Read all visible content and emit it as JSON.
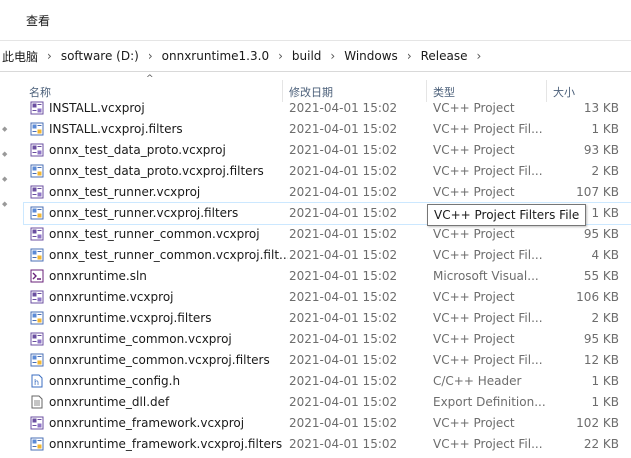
{
  "ribbon": {
    "view_tab": "查看"
  },
  "breadcrumb": {
    "items": [
      "此电脑",
      "software (D:)",
      "onnxruntime1.3.0",
      "build",
      "Windows",
      "Release"
    ],
    "separator": "›"
  },
  "columns": {
    "name": "名称",
    "modified": "修改日期",
    "type": "类型",
    "size": "大小",
    "sort_indicator": "^"
  },
  "tooltip": "VC++ Project Filters File",
  "colors": {
    "selection_border": "#cce8ff",
    "header_text": "#4c607a",
    "secondary_text": "#6d6d6d"
  },
  "files": [
    {
      "name": "INSTALL.vcxproj",
      "date": "2021-04-01 15:02",
      "type": "VC++ Project",
      "size": "13 KB",
      "icon": "vcxproj-icon"
    },
    {
      "name": "INSTALL.vcxproj.filters",
      "date": "2021-04-01 15:02",
      "type": "VC++ Project Fil...",
      "size": "1 KB",
      "icon": "filters-icon"
    },
    {
      "name": "onnx_test_data_proto.vcxproj",
      "date": "2021-04-01 15:02",
      "type": "VC++ Project",
      "size": "93 KB",
      "icon": "vcxproj-icon"
    },
    {
      "name": "onnx_test_data_proto.vcxproj.filters",
      "date": "2021-04-01 15:02",
      "type": "VC++ Project Fil...",
      "size": "2 KB",
      "icon": "filters-icon"
    },
    {
      "name": "onnx_test_runner.vcxproj",
      "date": "2021-04-01 15:02",
      "type": "VC++ Project",
      "size": "107 KB",
      "icon": "vcxproj-icon"
    },
    {
      "name": "onnx_test_runner.vcxproj.filters",
      "date": "2021-04-01 15:02",
      "type": "VC++ Project Filters File",
      "size": "1 KB",
      "icon": "filters-icon"
    },
    {
      "name": "onnx_test_runner_common.vcxproj",
      "date": "2021-04-01 15:02",
      "type": "VC++ Project",
      "size": "95 KB",
      "icon": "vcxproj-icon"
    },
    {
      "name": "onnx_test_runner_common.vcxproj.filt...",
      "date": "2021-04-01 15:02",
      "type": "VC++ Project Fil...",
      "size": "4 KB",
      "icon": "filters-icon"
    },
    {
      "name": "onnxruntime.sln",
      "date": "2021-04-01 15:02",
      "type": "Microsoft Visual...",
      "size": "55 KB",
      "icon": "sln-icon"
    },
    {
      "name": "onnxruntime.vcxproj",
      "date": "2021-04-01 15:02",
      "type": "VC++ Project",
      "size": "106 KB",
      "icon": "vcxproj-icon"
    },
    {
      "name": "onnxruntime.vcxproj.filters",
      "date": "2021-04-01 15:02",
      "type": "VC++ Project Fil...",
      "size": "2 KB",
      "icon": "filters-icon"
    },
    {
      "name": "onnxruntime_common.vcxproj",
      "date": "2021-04-01 15:02",
      "type": "VC++ Project",
      "size": "95 KB",
      "icon": "vcxproj-icon"
    },
    {
      "name": "onnxruntime_common.vcxproj.filters",
      "date": "2021-04-01 15:02",
      "type": "VC++ Project Fil...",
      "size": "12 KB",
      "icon": "filters-icon"
    },
    {
      "name": "onnxruntime_config.h",
      "date": "2021-04-01 15:02",
      "type": "C/C++ Header",
      "size": "1 KB",
      "icon": "header-file-icon"
    },
    {
      "name": "onnxruntime_dll.def",
      "date": "2021-04-01 15:02",
      "type": "Export Definition...",
      "size": "1 KB",
      "icon": "def-file-icon"
    },
    {
      "name": "onnxruntime_framework.vcxproj",
      "date": "2021-04-01 15:02",
      "type": "VC++ Project",
      "size": "102 KB",
      "icon": "vcxproj-icon"
    },
    {
      "name": "onnxruntime_framework.vcxproj.filters",
      "date": "2021-04-01 15:02",
      "type": "VC++ Project Fil...",
      "size": "22 KB",
      "icon": "filters-icon"
    }
  ]
}
